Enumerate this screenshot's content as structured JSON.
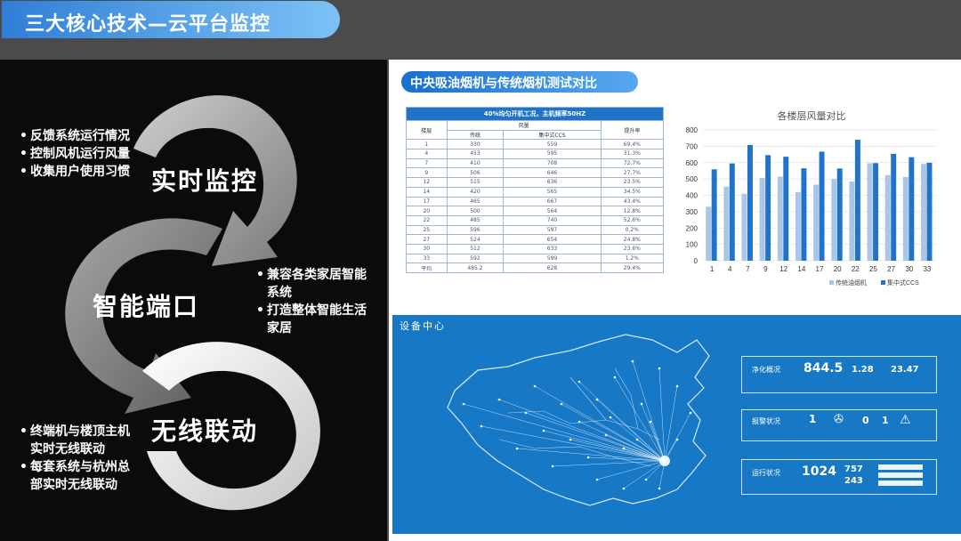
{
  "title": "三大核心技术—云平台监控",
  "left": {
    "sections": [
      {
        "label": "实时监控"
      },
      {
        "label": "智能端口"
      },
      {
        "label": "无线联动"
      }
    ],
    "bullets_a": [
      "反馈系统运行情况",
      "控制风机运行风量",
      "收集用户使用习惯"
    ],
    "bullets_b": [
      "兼容各类家居智能",
      "系统",
      "打造整体智能生活",
      "家居"
    ],
    "bullets_c": [
      "终端机与楼顶主机",
      "实时无线联动",
      "每套系统与杭州总",
      "部实时无线联动"
    ]
  },
  "right": {
    "subtitle": "中央吸油烟机与传统烟机测试对比",
    "table": {
      "caption": "40%均匀开机工况，主机频率50HZ",
      "col_floor": "楼层",
      "col_air": "风量",
      "col_trad": "传统",
      "col_ccs": "集中式CCS",
      "col_rate": "提升率",
      "rows": [
        [
          "1",
          "330",
          "559",
          "69.4%"
        ],
        [
          "4",
          "453",
          "595",
          "31.3%"
        ],
        [
          "7",
          "410",
          "708",
          "72.7%"
        ],
        [
          "9",
          "506",
          "646",
          "27.7%"
        ],
        [
          "12",
          "515",
          "636",
          "23.5%"
        ],
        [
          "14",
          "420",
          "565",
          "34.5%"
        ],
        [
          "17",
          "465",
          "667",
          "43.4%"
        ],
        [
          "20",
          "500",
          "564",
          "12.8%"
        ],
        [
          "22",
          "485",
          "740",
          "52.6%"
        ],
        [
          "25",
          "596",
          "597",
          "0.2%"
        ],
        [
          "27",
          "524",
          "654",
          "24.8%"
        ],
        [
          "30",
          "512",
          "633",
          "23.6%"
        ],
        [
          "33",
          "592",
          "599",
          "1.2%"
        ],
        [
          "平均",
          "485.2",
          "628",
          "29.4%"
        ]
      ]
    }
  },
  "chart_data": {
    "type": "bar",
    "title": "各楼层风量对比",
    "categories": [
      "1",
      "4",
      "7",
      "9",
      "12",
      "14",
      "17",
      "20",
      "22",
      "25",
      "27",
      "30",
      "33"
    ],
    "series": [
      {
        "name": "传统油烟机",
        "values": [
          330,
          453,
          410,
          506,
          515,
          420,
          465,
          500,
          485,
          596,
          524,
          512,
          592
        ],
        "color": "#a9c6e6"
      },
      {
        "name": "集中式CCS",
        "values": [
          559,
          595,
          708,
          646,
          636,
          565,
          667,
          564,
          740,
          597,
          654,
          633,
          599
        ],
        "color": "#1f74c9"
      }
    ],
    "ylim": [
      0,
      800
    ],
    "yticks": [
      "0",
      "100",
      "200",
      "300",
      "400",
      "500",
      "600",
      "700",
      "800"
    ],
    "grid": true,
    "legend": "bottom-right"
  },
  "device": {
    "title": "设备中心",
    "purify_label": "净化概况",
    "purify_val1": "844.5",
    "purify_val2": "1.28",
    "purify_val3": "23.47",
    "alarm_label": "报警状况",
    "alarm_val1": "1",
    "alarm_val2": "0",
    "alarm_val3": "1",
    "run_label": "运行状况",
    "run_total": "1024",
    "run_online": "757",
    "run_offline": "243"
  }
}
